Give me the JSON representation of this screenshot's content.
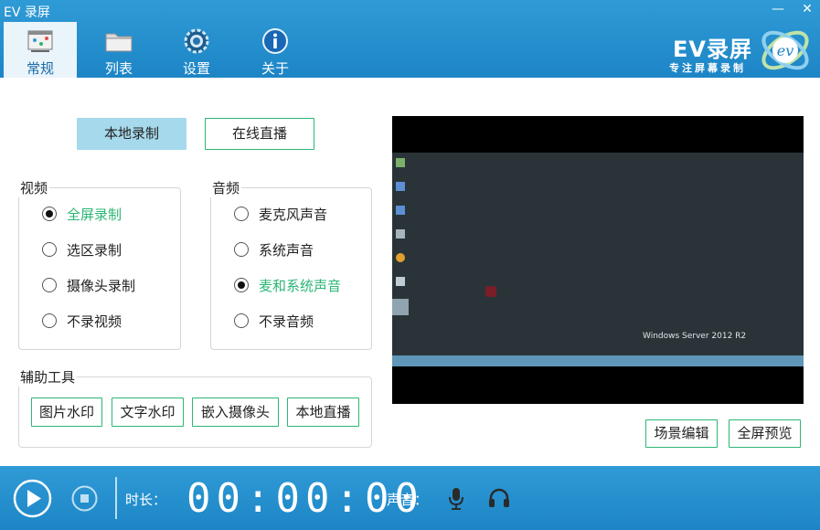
{
  "window": {
    "title": "EV 录屏",
    "minimize": "—",
    "close": "✕"
  },
  "tabs": [
    {
      "label": "常规",
      "icon": "general-icon"
    },
    {
      "label": "列表",
      "icon": "folder-icon"
    },
    {
      "label": "设置",
      "icon": "gear-icon"
    },
    {
      "label": "关于",
      "icon": "info-icon"
    }
  ],
  "logo": {
    "text": "EV录屏",
    "subtitle": "专注屏幕录制"
  },
  "mode": {
    "local": "本地录制",
    "live": "在线直播"
  },
  "video": {
    "label": "视频",
    "options": [
      "全屏录制",
      "选区录制",
      "摄像头录制",
      "不录视频"
    ],
    "selected": 0
  },
  "audio": {
    "label": "音频",
    "options": [
      "麦克风声音",
      "系统声音",
      "麦和系统声音",
      "不录音频"
    ],
    "selected": 2
  },
  "tools": {
    "label": "辅助工具",
    "buttons": [
      "图片水印",
      "文字水印",
      "嵌入摄像头",
      "本地直播"
    ]
  },
  "preview": {
    "watermark": "Windows Server 2012 R2"
  },
  "scene_edit": "场景编辑",
  "fullscreen_preview": "全屏预览",
  "bottom": {
    "duration_label": "时长：",
    "time": "00:00:00",
    "sound_label": "声音："
  },
  "colors": {
    "accent_blue": "#1d85c6",
    "green": "#2bb673",
    "selected_button": "#a6d9ec"
  }
}
